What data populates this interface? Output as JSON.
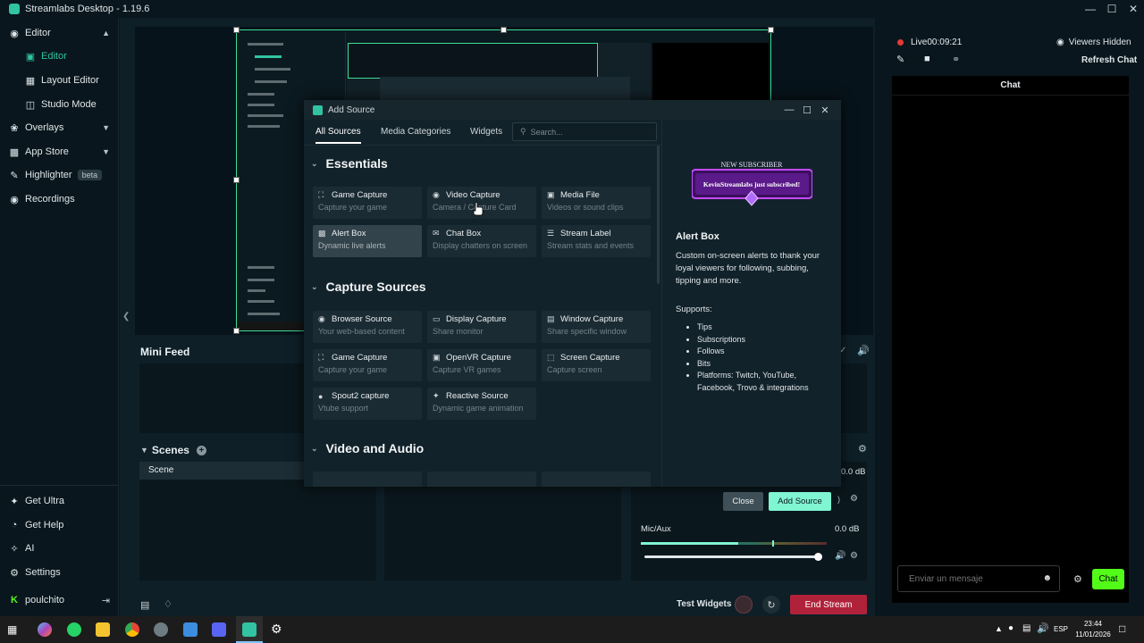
{
  "window": {
    "title": "Streamlabs Desktop - 1.19.6"
  },
  "sidebar": {
    "items": [
      {
        "label": "Editor",
        "icon": "palette-icon"
      },
      {
        "label": "Editor",
        "icon": "grid-icon"
      },
      {
        "label": "Layout Editor",
        "icon": "layout-icon"
      },
      {
        "label": "Studio Mode",
        "icon": "studio-icon"
      },
      {
        "label": "Overlays",
        "icon": "palette-icon"
      },
      {
        "label": "App Store",
        "icon": "store-icon"
      },
      {
        "label": "Highlighter",
        "icon": "highlighter-icon",
        "badge": "beta"
      },
      {
        "label": "Recordings",
        "icon": "record-icon"
      }
    ],
    "bottom": [
      {
        "label": "Get Ultra"
      },
      {
        "label": "Get Help"
      },
      {
        "label": "AI"
      },
      {
        "label": "Settings"
      },
      {
        "label": "poulchito"
      }
    ]
  },
  "minifeed": {
    "title": "Mini Feed"
  },
  "scenes": {
    "title": "Scenes",
    "items": [
      "Scene"
    ]
  },
  "mixer": {
    "top_db": "0.0 dB",
    "mic_label": "Mic/Aux",
    "mic_db": "0.0 dB",
    "mic_volume": 1.0
  },
  "footer": {
    "test_widgets": "Test Widgets",
    "end_stream": "End Stream"
  },
  "live": {
    "status": "Live",
    "time": "00:09:21",
    "viewers": "Viewers Hidden",
    "refresh_chat": "Refresh Chat"
  },
  "chat": {
    "title": "Chat",
    "placeholder": "Enviar un mensaje",
    "send_label": "Chat"
  },
  "modal": {
    "title": "Add Source",
    "tabs": [
      "All Sources",
      "Media Categories",
      "Widgets"
    ],
    "search_placeholder": "Search...",
    "sections": [
      {
        "title": "Essentials",
        "items": [
          {
            "name": "Game Capture",
            "desc": "Capture your game",
            "icon": "gamepad-icon"
          },
          {
            "name": "Video Capture",
            "desc": "Camera / Capture Card",
            "icon": "camera-icon"
          },
          {
            "name": "Media File",
            "desc": "Videos or sound clips",
            "icon": "media-file-icon"
          },
          {
            "name": "Alert Box",
            "desc": "Dynamic live alerts",
            "icon": "alert-icon"
          },
          {
            "name": "Chat Box",
            "desc": "Display chatters on screen",
            "icon": "chat-icon"
          },
          {
            "name": "Stream Label",
            "desc": "Stream stats and events",
            "icon": "label-icon"
          }
        ]
      },
      {
        "title": "Capture Sources",
        "items": [
          {
            "name": "Browser Source",
            "desc": "Your web-based content",
            "icon": "globe-icon"
          },
          {
            "name": "Display Capture",
            "desc": "Share monitor",
            "icon": "monitor-icon"
          },
          {
            "name": "Window Capture",
            "desc": "Share specific window",
            "icon": "window-icon"
          },
          {
            "name": "Game Capture",
            "desc": "Capture your game",
            "icon": "gamepad-icon"
          },
          {
            "name": "OpenVR Capture",
            "desc": "Capture VR games",
            "icon": "vr-icon"
          },
          {
            "name": "Screen Capture",
            "desc": "Capture screen",
            "icon": "screen-icon"
          },
          {
            "name": "Spout2 capture",
            "desc": "Vtube support",
            "icon": "spout-icon"
          },
          {
            "name": "Reactive Source",
            "desc": "Dynamic game animation",
            "icon": "sparkle-icon"
          }
        ]
      },
      {
        "title": "Video and Audio"
      }
    ],
    "detail": {
      "title": "Alert Box",
      "description": "Custom on-screen alerts to thank your loyal viewers for following, subbing, tipping and more.",
      "supports_label": "Supports:",
      "supports": [
        "Tips",
        "Subscriptions",
        "Follows",
        "Bits",
        "Platforms: Twitch, YouTube, Facebook, Trovo & integrations"
      ],
      "preview_top": "NEW SUBSCRIBER",
      "preview_name": "KevinStreamlabs",
      "preview_text": "just subscribed!"
    },
    "close_label": "Close",
    "add_label": "Add Source"
  },
  "taskbar": {
    "lang": "ESP",
    "time": "23:44",
    "date": "11/01/2026"
  },
  "colors": {
    "accent": "#31c3a2",
    "add_button": "#80f5d2",
    "end_stream": "#b0223a",
    "live_dot": "#e53935"
  }
}
